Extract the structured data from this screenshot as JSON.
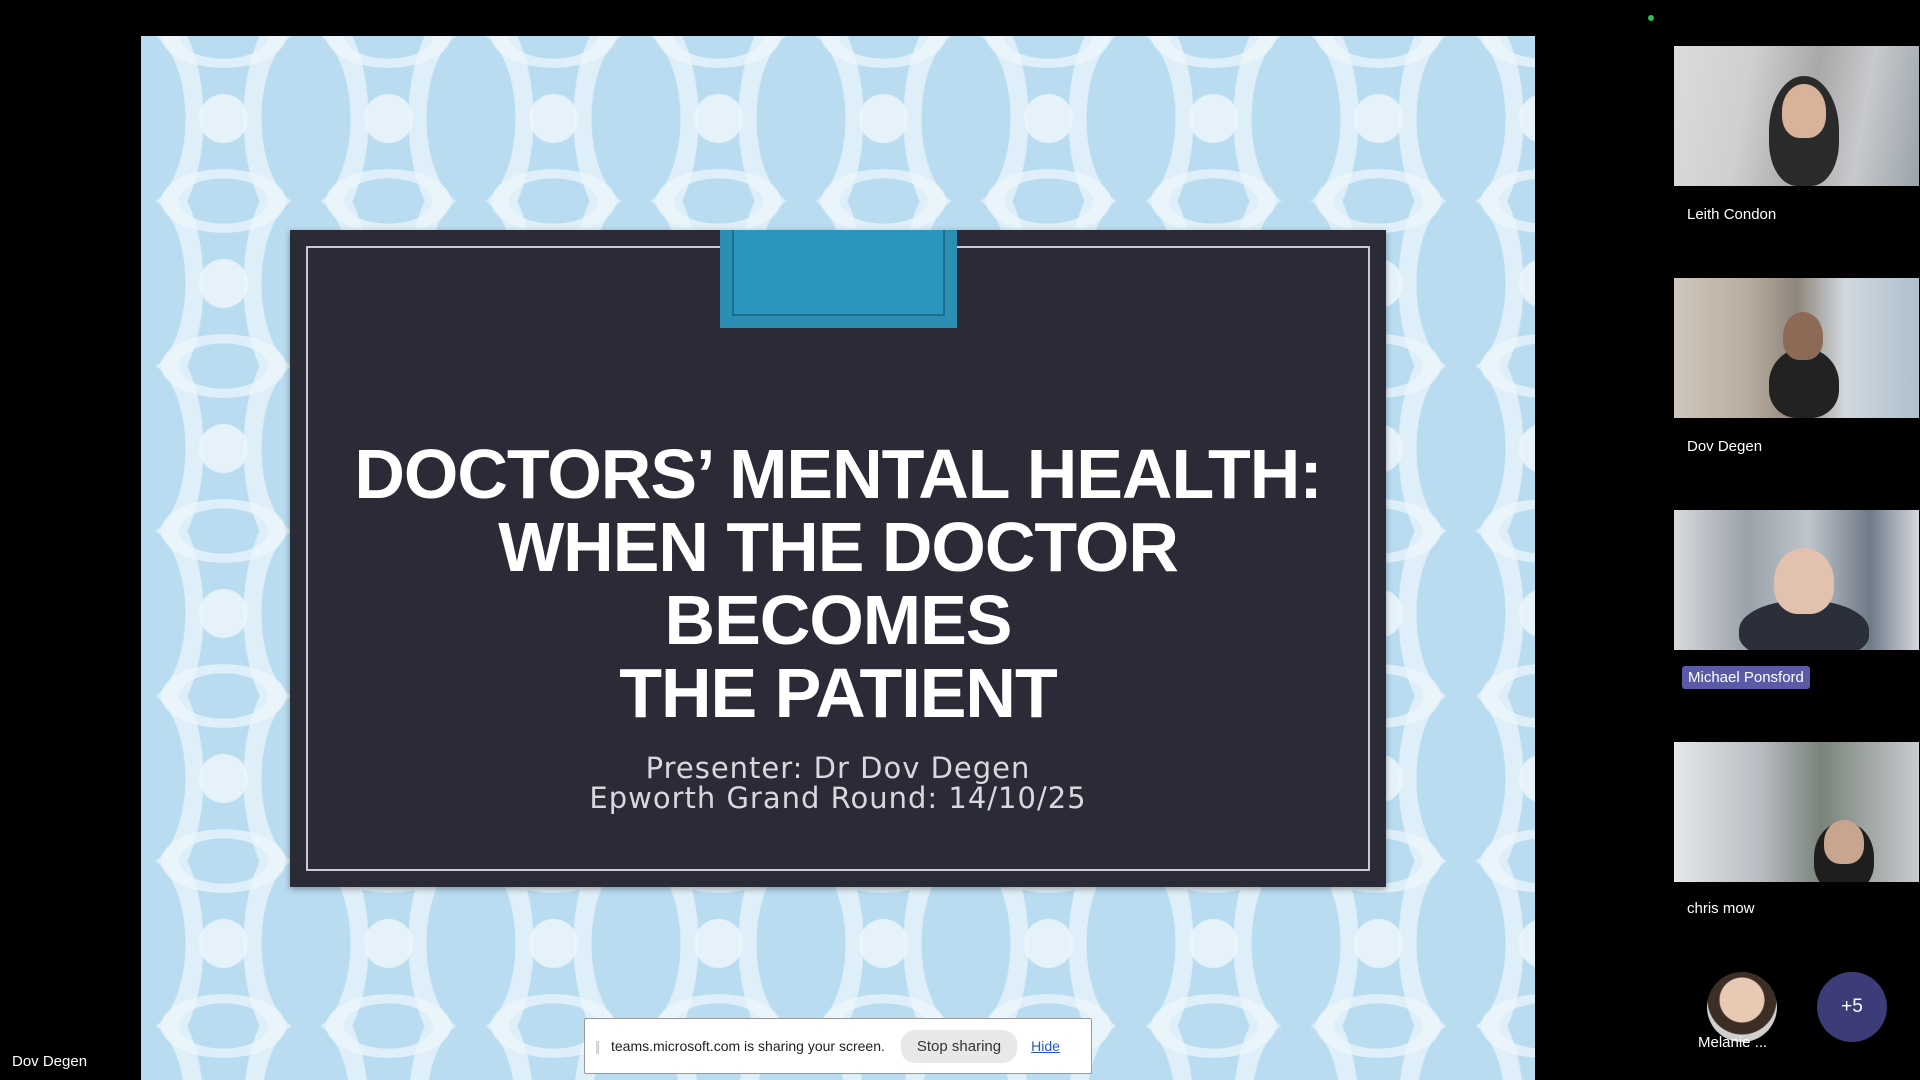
{
  "slide": {
    "title_lines": [
      "DOCTORS’ MENTAL HEALTH:",
      "WHEN THE DOCTOR BECOMES",
      "THE PATIENT"
    ],
    "presenter": "Presenter: Dr Dov Degen",
    "event": "Epworth Grand Round: 14/10/25"
  },
  "share_bar": {
    "handle": "||",
    "message": "teams.microsoft.com is sharing your screen.",
    "stop_label": "Stop sharing",
    "hide_label": "Hide"
  },
  "participants": [
    {
      "name": "Leith Condon"
    },
    {
      "name": "Dov Degen"
    },
    {
      "name": "Michael Ponsford"
    },
    {
      "name": "chris mow"
    }
  ],
  "overflow": {
    "name": "Melanie ...",
    "more_label": "+5"
  },
  "presenter_name": "Dov Degen",
  "colors": {
    "slide_bg": "#b9dcf0",
    "card_bg": "#2b2b38",
    "tab": "#2a8fb3",
    "active_speaker": "#5a5aa6",
    "more_bubble": "#3c3c78",
    "status_dot": "#2fbf4f"
  }
}
